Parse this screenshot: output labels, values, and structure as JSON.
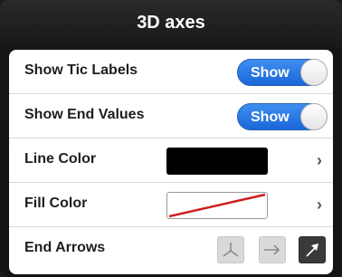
{
  "popover": {
    "title": "3D axes"
  },
  "rows": {
    "tic_labels": {
      "label": "Show Tic Labels",
      "toggle_text": "Show"
    },
    "end_values": {
      "label": "Show End Values",
      "toggle_text": "Show"
    },
    "line_color": {
      "label": "Line Color",
      "color": "#000000"
    },
    "fill_color": {
      "label": "Fill Color",
      "color": "none"
    },
    "end_arrows": {
      "label": "End Arrows",
      "options": [
        "axes-icon",
        "right-arrow-icon",
        "arrow-tip-icon"
      ],
      "selected": "arrow-tip-icon"
    }
  },
  "colors": {
    "accent": "#1a66d9",
    "none_indicator": "#cc1f1f"
  }
}
